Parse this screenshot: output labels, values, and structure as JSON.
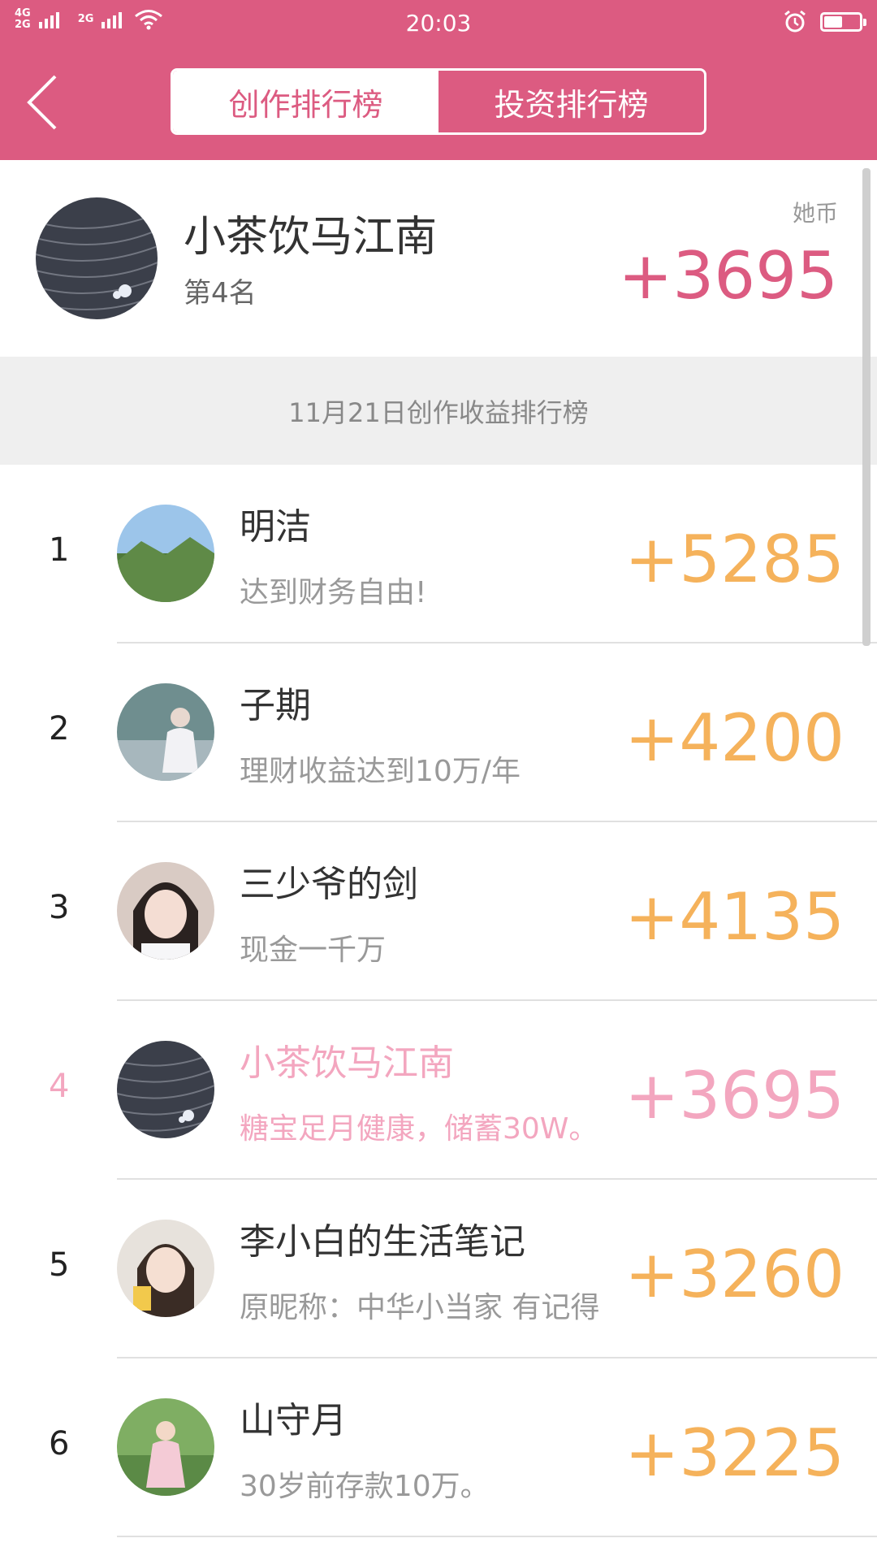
{
  "status_bar": {
    "network_top": "4G",
    "network_bottom": "2G",
    "network_2": "2G",
    "time": "20:03",
    "icons": [
      "signal-icon",
      "wifi-icon",
      "alarm-icon",
      "battery-icon"
    ],
    "battery_level": 0.5
  },
  "header": {
    "back_icon": "chevron-left-icon",
    "tabs": [
      {
        "label": "创作排行榜",
        "active": true
      },
      {
        "label": "投资排行榜",
        "active": false
      }
    ]
  },
  "my_rank": {
    "name": "小茶饮马江南",
    "rank_label": "第4名",
    "currency_label": "她币",
    "points": "+3695"
  },
  "section_title": "11月21日创作收益排行榜",
  "leaderboard": [
    {
      "rank": "1",
      "name": "明洁",
      "motto": "达到财务自由!",
      "points": "+5285"
    },
    {
      "rank": "2",
      "name": "子期",
      "motto": "理财收益达到10万/年",
      "points": "+4200"
    },
    {
      "rank": "3",
      "name": "三少爷的剑",
      "motto": "现金一千万",
      "points": "+4135"
    },
    {
      "rank": "4",
      "name": "小茶饮马江南",
      "motto": "糖宝足月健康，储蓄30W。",
      "points": "+3695"
    },
    {
      "rank": "5",
      "name": "李小白的生活笔记",
      "motto": "原昵称：中华小当家  有记得",
      "points": "+3260"
    },
    {
      "rank": "6",
      "name": "山守月",
      "motto": "30岁前存款10万。",
      "points": "+3225"
    }
  ],
  "colors": {
    "brand": "#dc5b81",
    "points": "#f5b25b",
    "highlight": "#f3a6bf"
  }
}
